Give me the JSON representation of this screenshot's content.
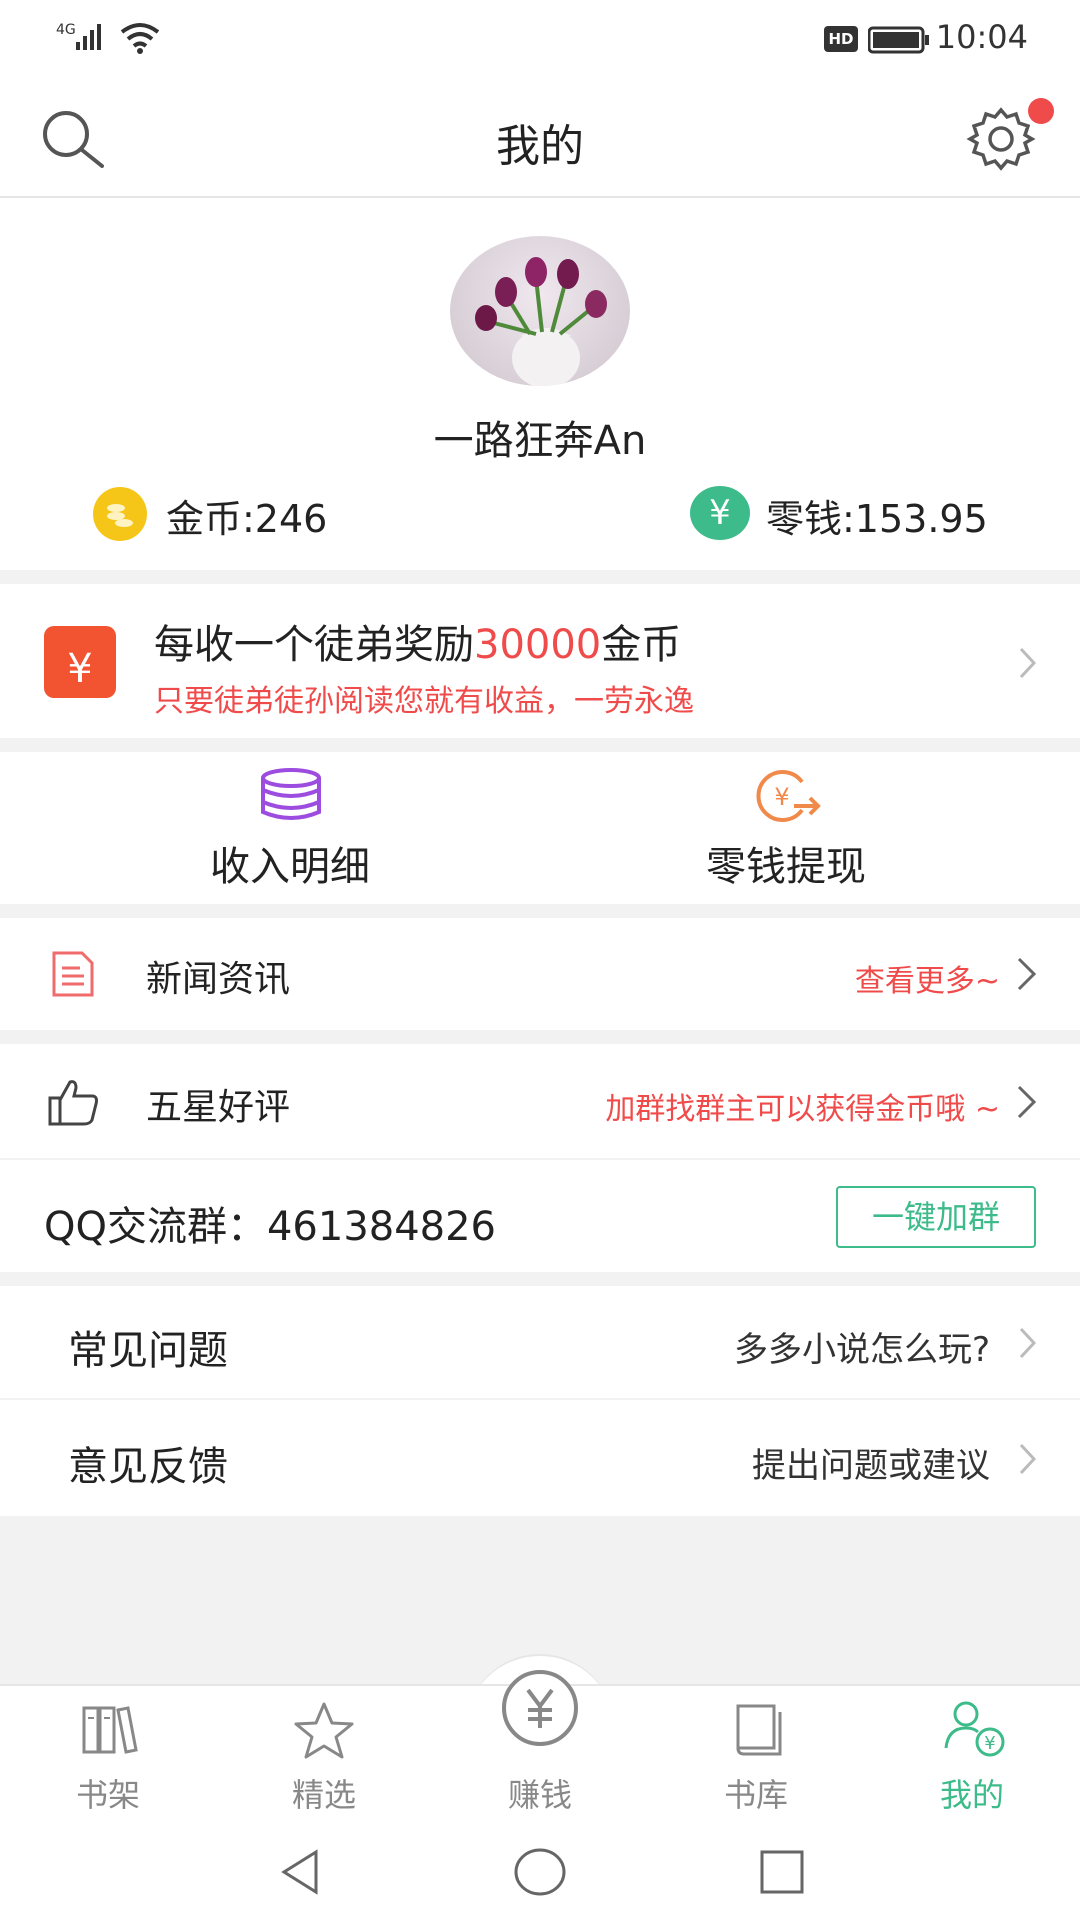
{
  "status_bar": {
    "network": "4G",
    "hd": "HD",
    "time": "10:04"
  },
  "header": {
    "title": "我的"
  },
  "profile": {
    "username": "一路狂奔An",
    "coins_label": "金币:246",
    "change_label": "零钱:153.95",
    "yuan_symbol": "¥"
  },
  "invite": {
    "title_prefix": "每收一个徒弟奖励",
    "title_highlight": "30000",
    "title_suffix": "金币",
    "subtitle": "只要徒弟徒孙阅读您就有收益，一劳永逸",
    "yuan_symbol": "¥"
  },
  "actions": [
    {
      "label": "收入明细",
      "icon": "database-icon"
    },
    {
      "label": "零钱提现",
      "icon": "withdraw-yuan-icon"
    }
  ],
  "news": {
    "label": "新闻资讯",
    "right": "查看更多~"
  },
  "rating": {
    "label": "五星好评",
    "right": "加群找群主可以获得金币哦 ~"
  },
  "qq": {
    "label": "QQ交流群：461384826",
    "button": "一键加群"
  },
  "faq": {
    "label": "常见问题",
    "right": "多多小说怎么玩?"
  },
  "feedback": {
    "label": "意见反馈",
    "right": "提出问题或建议"
  },
  "bottom_nav": {
    "items": [
      {
        "label": "书架",
        "icon": "bookshelf-icon"
      },
      {
        "label": "精选",
        "icon": "star-icon"
      },
      {
        "label": "赚钱",
        "icon": "yuan-circle-icon"
      },
      {
        "label": "书库",
        "icon": "book-library-icon"
      },
      {
        "label": "我的",
        "icon": "user-yuan-icon"
      }
    ],
    "active_index": 4
  },
  "colors": {
    "accent_green": "#3dbb8a",
    "accent_red": "#f04b4b",
    "invite_orange": "#f25432"
  }
}
